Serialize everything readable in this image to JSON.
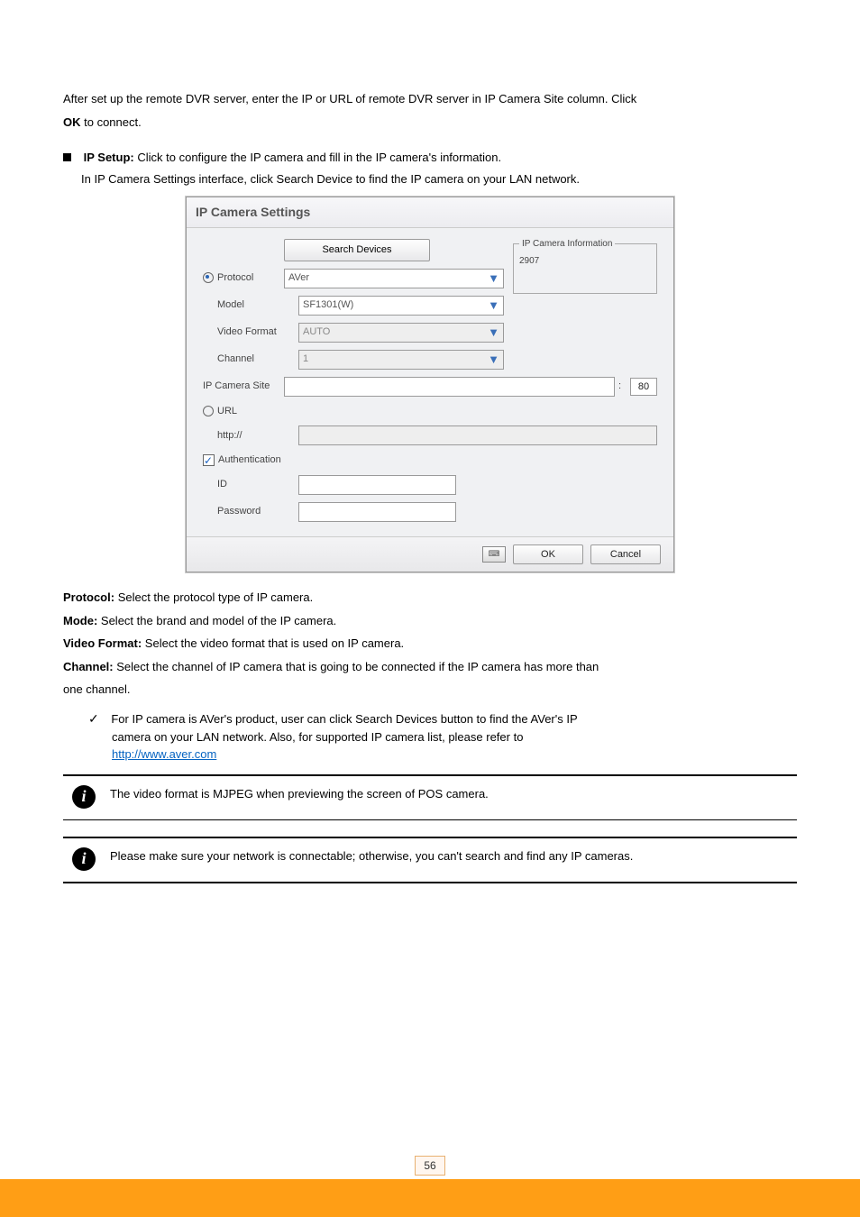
{
  "top": {
    "l1": "After set up the remote DVR server, enter the IP or URL of remote DVR server in IP Camera Site column. Click",
    "l2_1": "OK",
    "l2_2": "to connect."
  },
  "ipsetup": {
    "bullet_bold": "IP Setup:",
    "bullet_rest": "Click to configure the IP camera and fill in the IP camera's information.",
    "indent_line": "In IP Camera Settings interface, click Search Device to find the IP camera on your LAN network."
  },
  "dialog": {
    "title": "IP Camera Settings",
    "search_btn": "Search Devices",
    "ipinfo_legend": "IP Camera Information",
    "ipinfo_val": "2907",
    "protocol_lbl": "Protocol",
    "protocol_val": "AVer",
    "model_lbl": "Model",
    "model_val": "SF1301(W)",
    "vf_lbl": "Video Format",
    "vf_val": "AUTO",
    "channel_lbl": "Channel",
    "channel_val": "1",
    "site_lbl": "IP Camera Site",
    "port_colon": ":",
    "port_val": "80",
    "url_lbl": "URL",
    "http_lbl": "http://",
    "auth_lbl": "Authentication",
    "id_lbl": "ID",
    "pw_lbl": "Password",
    "ok": "OK",
    "cancel": "Cancel"
  },
  "below": {
    "l1_bold": "Protocol:",
    "l1_rest": "Select the protocol type of IP camera.",
    "l2_bold": "Mode:",
    "l2_rest": "Select the brand and model of the IP camera.",
    "l3_bold": "Video Format:",
    "l3_rest": "Select the video format that is used on IP camera.",
    "l4_bold": "Channel:",
    "l4_rest": "Select the channel of IP camera that is going to be connected if the IP camera has more than",
    "l5": "one channel.",
    "tick_text": "For IP camera is AVer's product, user can click Search Devices button to find the AVer's IP",
    "tick_line2": "camera on your LAN network. Also, for supported IP camera list, please refer to",
    "tick_link": "http://www.aver.com"
  },
  "info1": "The video format is MJPEG when previewing the screen of POS camera.",
  "info2_a": "Please make sure your network is connectable; otherwise, you ",
  "info2_b": "can'",
  "info2_c": "t search and find any IP cameras.",
  "page_number": "56"
}
